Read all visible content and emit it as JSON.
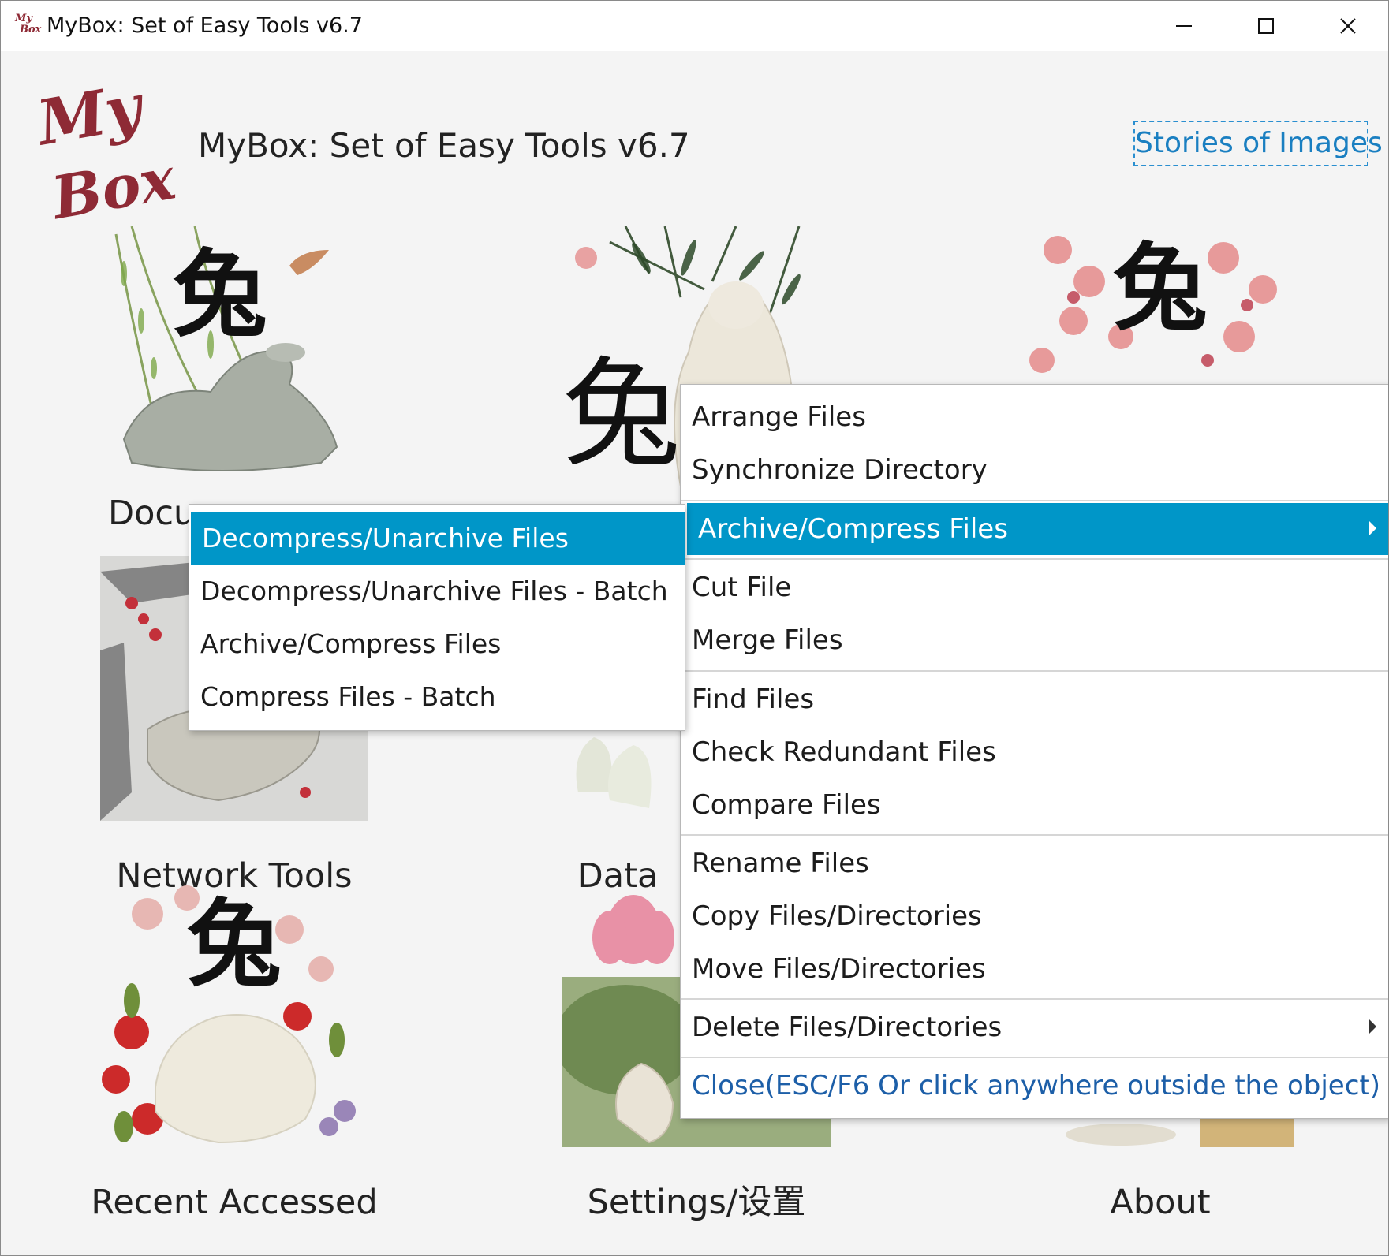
{
  "window": {
    "title": "MyBox: Set of Easy Tools v6.7",
    "icon_text_line1": "My",
    "icon_text_line2": "Box"
  },
  "header": {
    "logo_line1": "My",
    "logo_line2": "Box",
    "heading": "MyBox: Set of Easy Tools v6.7",
    "stories_link": "Stories of Images"
  },
  "tiles": [
    {
      "label": "Docu",
      "glyph": "兔"
    },
    {
      "label": "",
      "glyph": "兔"
    },
    {
      "label": "",
      "glyph": "兔"
    },
    {
      "label": "Network Tools"
    },
    {
      "label": "Data"
    },
    {
      "label": "Recent Accessed",
      "glyph": "兔"
    },
    {
      "label": "Settings/设置"
    },
    {
      "label": "About"
    }
  ],
  "file_menu": {
    "items": [
      {
        "label": "Arrange Files"
      },
      {
        "label": "Synchronize Directory"
      },
      {
        "label": "Archive/Compress Files",
        "has_submenu": true,
        "selected": true
      },
      {
        "label": "Cut File"
      },
      {
        "label": "Merge Files"
      },
      {
        "label": "Find Files"
      },
      {
        "label": "Check Redundant Files"
      },
      {
        "label": "Compare Files"
      },
      {
        "label": "Rename Files"
      },
      {
        "label": "Copy Files/Directories"
      },
      {
        "label": "Move Files/Directories"
      },
      {
        "label": "Delete Files/Directories",
        "has_submenu": true
      },
      {
        "label": "Close(ESC/F6 Or click anywhere outside the object)"
      }
    ]
  },
  "archive_submenu": {
    "items": [
      {
        "label": "Decompress/Unarchive Files",
        "selected": true
      },
      {
        "label": "Decompress/Unarchive Files - Batch"
      },
      {
        "label": "Archive/Compress Files"
      },
      {
        "label": "Compress Files - Batch"
      }
    ]
  },
  "colors": {
    "menu_highlight": "#0096c8",
    "link": "#1a7fc1",
    "logo": "#8e2a35"
  }
}
